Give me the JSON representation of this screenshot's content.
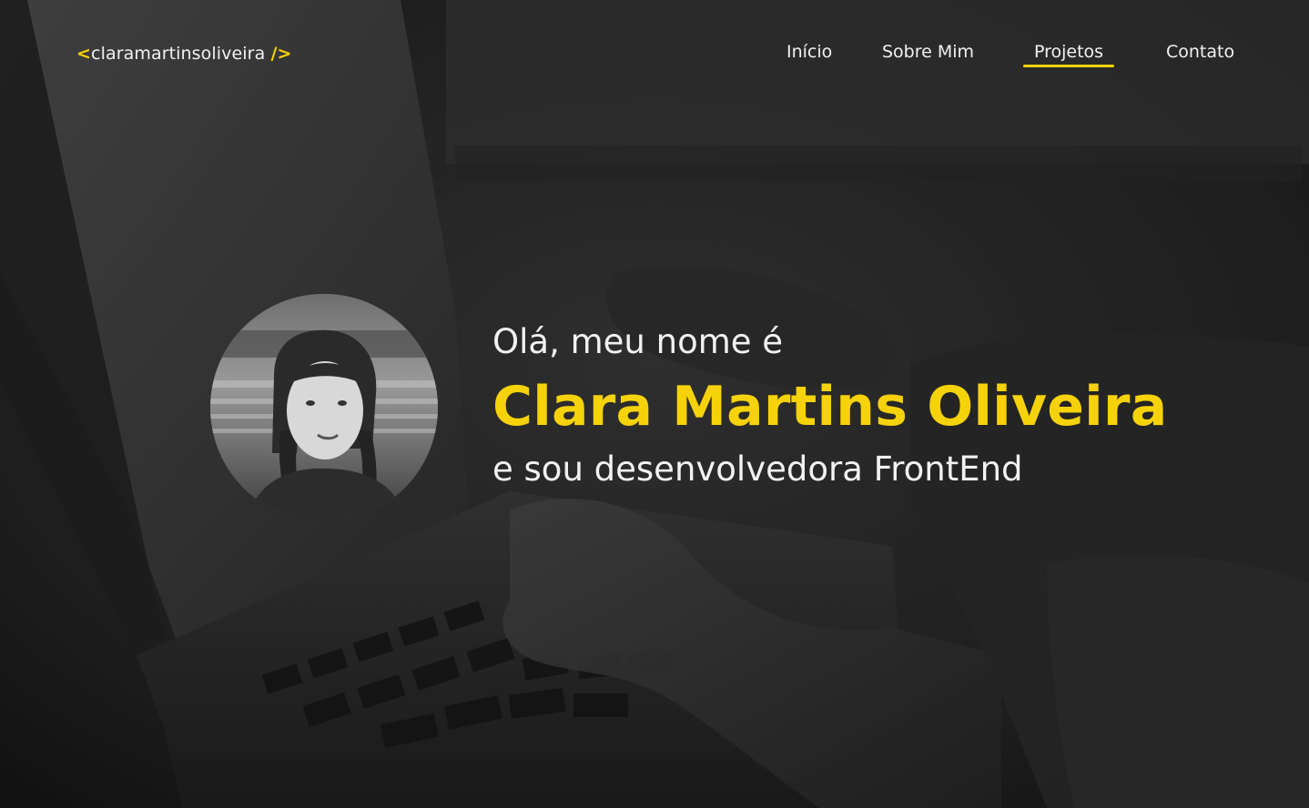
{
  "header": {
    "logo": {
      "open_bracket": "<",
      "name": "claramartinsoliveira",
      "close_bracket": "/>"
    },
    "nav": [
      {
        "label": "Início",
        "active": false
      },
      {
        "label": "Sobre Mim",
        "active": false
      },
      {
        "label": "Projetos",
        "active": true
      },
      {
        "label": "Contato",
        "active": false
      }
    ]
  },
  "hero": {
    "greeting": "Olá, meu nome é",
    "name": "Clara Martins Oliveira",
    "role": "e sou desenvolvedora FrontEnd"
  },
  "colors": {
    "accent": "#f6d20a",
    "text": "#f2f2f2",
    "background": "#1a1a1a"
  },
  "icons": {
    "avatar": "profile-photo",
    "background": "laptop-typing-photo"
  }
}
